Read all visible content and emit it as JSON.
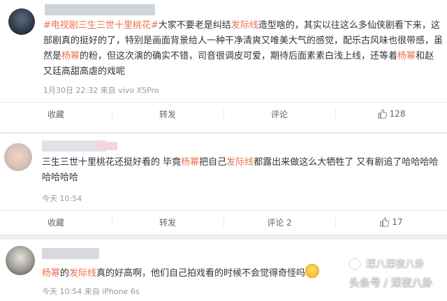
{
  "posts": [
    {
      "segments": [
        {
          "text": "#电视剧三生三世十里桃花#",
          "style": "tag"
        },
        {
          "text": "大家不要老是纠结",
          "style": "plain"
        },
        {
          "text": "发际线",
          "style": "hl"
        },
        {
          "text": "造型啥的，其实以往这么多仙侠剧看下来，这部剧真的挺好的了，特别是画面背景给人一种干净清爽又唯美大气的感觉，配乐古风味也很带感，虽然是",
          "style": "plain"
        },
        {
          "text": "杨幂",
          "style": "hl"
        },
        {
          "text": "的粉，但这次演的确实不错，司音很调皮可爱，期待后面素素白浅上线，还等着",
          "style": "plain"
        },
        {
          "text": "杨幂",
          "style": "hl"
        },
        {
          "text": "和赵又廷高甜高虐的戏呢",
          "style": "plain"
        }
      ],
      "meta": "1月30日 22:32 来自 vivo X5Pro",
      "actions": {
        "favorite": "收藏",
        "repost": "转发",
        "comment": "评论",
        "likes": "128"
      }
    },
    {
      "segments": [
        {
          "text": "三生三世十里桃花还挺好看的 毕竟",
          "style": "plain"
        },
        {
          "text": "杨幂",
          "style": "hl"
        },
        {
          "text": "把自己",
          "style": "plain"
        },
        {
          "text": "发际线",
          "style": "hl"
        },
        {
          "text": "都露出来做这么大牺牲了 又有剧追了哈哈哈哈哈哈哈哈",
          "style": "plain"
        }
      ],
      "meta": "今天 10:54",
      "actions": {
        "favorite": "收藏",
        "repost": "转发",
        "comment": "评论 2",
        "likes": "17"
      }
    },
    {
      "segments": [
        {
          "text": "杨幂",
          "style": "hl"
        },
        {
          "text": "的",
          "style": "plain"
        },
        {
          "text": "发际线",
          "style": "hl"
        },
        {
          "text": "真的好高啊，他们自己拍戏看的时候不会觉得奇怪吗",
          "style": "plain"
        }
      ],
      "meta": "今天 10:54 来自 iPhone 6s"
    }
  ],
  "watermark": {
    "line1": "深八深夜八卦",
    "line2": "头条号 / 深夜八卦"
  },
  "icons": {
    "like": "thumbs-up-icon",
    "emoji": "awkward-face-emoji"
  },
  "colors": {
    "highlight": "#eb7350",
    "meta": "#999999",
    "background": "#ecedf0"
  }
}
